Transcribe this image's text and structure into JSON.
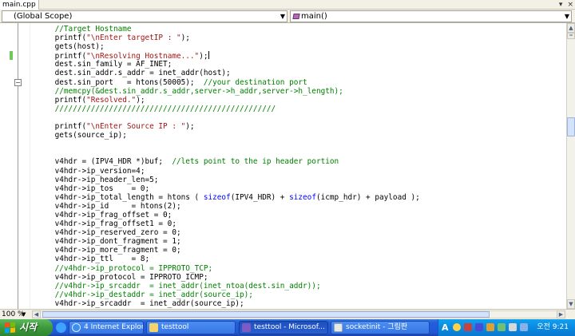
{
  "editor_tab": {
    "label": "main.cpp"
  },
  "tab_tools": {
    "dropdown": "▾",
    "close": "×"
  },
  "scope": {
    "left": "(Global Scope)",
    "right": "main()"
  },
  "zoom_level": "100 %",
  "code_lines": [
    [
      {
        "t": "    //Target Hostname",
        "c": "cm"
      }
    ],
    [
      {
        "t": "    printf(",
        "c": ""
      },
      {
        "t": "\"\\nEnter targetIP : \"",
        "c": "st"
      },
      {
        "t": ");",
        "c": ""
      }
    ],
    [
      {
        "t": "    gets(host);",
        "c": ""
      }
    ],
    [
      {
        "t": "    printf(",
        "c": ""
      },
      {
        "t": "\"\\nResolving Hostname...\"",
        "c": "st"
      },
      {
        "t": ");",
        "c": ""
      },
      {
        "t": "",
        "c": "caret"
      }
    ],
    [
      {
        "t": "    dest.sin_family = AF_INET;",
        "c": ""
      }
    ],
    [
      {
        "t": "    dest.sin_addr.s_addr = inet_addr(host);",
        "c": ""
      }
    ],
    [
      {
        "t": "    dest.sin_port   = htons(50005);  ",
        "c": ""
      },
      {
        "t": "//your destination port",
        "c": "cm"
      }
    ],
    [
      {
        "t": "    //memcpy(&dest.sin_addr.s_addr,server->h_addr,server->h_length);",
        "c": "cm"
      }
    ],
    [
      {
        "t": "    printf(",
        "c": ""
      },
      {
        "t": "\"Resolved.\"",
        "c": "st"
      },
      {
        "t": ");",
        "c": ""
      }
    ],
    [
      {
        "t": "    /////////////////////////////////////////////////",
        "c": "cm"
      }
    ],
    [
      {
        "t": "",
        "c": ""
      }
    ],
    [
      {
        "t": "    printf(",
        "c": ""
      },
      {
        "t": "\"\\nEnter Source IP : \"",
        "c": "st"
      },
      {
        "t": ");",
        "c": ""
      }
    ],
    [
      {
        "t": "    gets(source_ip);",
        "c": ""
      }
    ],
    [
      {
        "t": "",
        "c": ""
      }
    ],
    [
      {
        "t": "",
        "c": ""
      }
    ],
    [
      {
        "t": "    v4hdr = (IPV4_HDR *)buf;  ",
        "c": ""
      },
      {
        "t": "//lets point to the ip header portion",
        "c": "cm"
      }
    ],
    [
      {
        "t": "    v4hdr->ip_version=4;",
        "c": ""
      }
    ],
    [
      {
        "t": "    v4hdr->ip_header_len=5;",
        "c": ""
      }
    ],
    [
      {
        "t": "    v4hdr->ip_tos    = 0;",
        "c": ""
      }
    ],
    [
      {
        "t": "    v4hdr->ip_total_length = htons ( ",
        "c": ""
      },
      {
        "t": "sizeof",
        "c": "kw"
      },
      {
        "t": "(IPV4_HDR) + ",
        "c": ""
      },
      {
        "t": "sizeof",
        "c": "kw"
      },
      {
        "t": "(icmp_hdr) + payload );",
        "c": ""
      }
    ],
    [
      {
        "t": "    v4hdr->ip_id     = htons(2);",
        "c": ""
      }
    ],
    [
      {
        "t": "    v4hdr->ip_frag_offset = 0;",
        "c": ""
      }
    ],
    [
      {
        "t": "    v4hdr->ip_frag_offset1 = 0;",
        "c": ""
      }
    ],
    [
      {
        "t": "    v4hdr->ip_reserved_zero = 0;",
        "c": ""
      }
    ],
    [
      {
        "t": "    v4hdr->ip_dont_fragment = 1;",
        "c": ""
      }
    ],
    [
      {
        "t": "    v4hdr->ip_more_fragment = 0;",
        "c": ""
      }
    ],
    [
      {
        "t": "    v4hdr->ip_ttl    = 8;",
        "c": ""
      }
    ],
    [
      {
        "t": "    //v4hdr->ip_protocol = IPPROTO_TCP;",
        "c": "cm"
      }
    ],
    [
      {
        "t": "    v4hdr->ip_protocol = IPPROTO_ICMP;",
        "c": ""
      }
    ],
    [
      {
        "t": "    //v4hdr->ip_srcaddr  = inet_addr(inet_ntoa(dest.sin_addr));",
        "c": "cm"
      }
    ],
    [
      {
        "t": "    //v4hdr->ip_destaddr = inet_addr(source_ip);",
        "c": "cm"
      }
    ],
    [
      {
        "t": "    v4hdr->ip_srcaddr  = inet_addr(source_ip);",
        "c": ""
      }
    ]
  ],
  "taskbar": {
    "start_label": "시작",
    "buttons": [
      {
        "label": "4 Internet Explorer",
        "icon": "ie-icon"
      },
      {
        "label": "testtool",
        "icon": "folder-icon"
      },
      {
        "label": "testtool - Microsof...",
        "icon": "visual-studio-icon"
      },
      {
        "label": "socketinit - 그림판",
        "icon": "paint-icon"
      }
    ],
    "tray_lang": "A",
    "clock": "오전 9:21"
  },
  "colors": {
    "comment": "#008000",
    "string": "#a31515",
    "keyword": "#0000ff",
    "taskbar": "#245edc",
    "start": "#3c9a3c",
    "tray": "#0a8ae0"
  }
}
